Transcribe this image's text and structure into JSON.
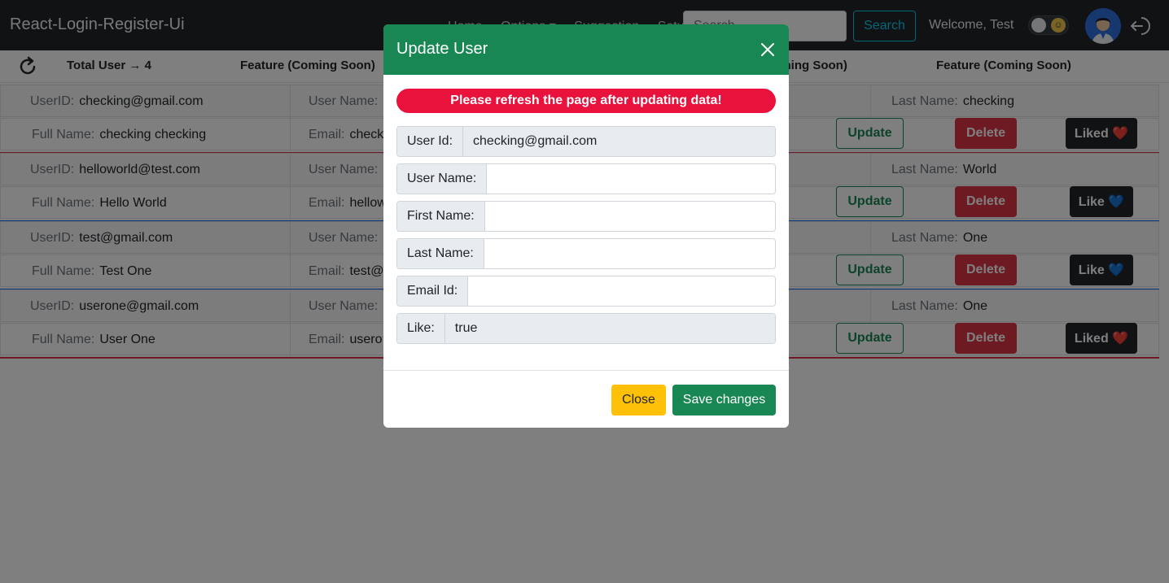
{
  "navbar": {
    "brand": "React-Login-Register-Ui",
    "links": [
      "Home",
      "Options ▾",
      "Suggestion",
      "Setup"
    ],
    "search_placeholder": "Search",
    "search_button": "Search",
    "welcome": "Welcome, Test"
  },
  "toolbar": {
    "total_users": "Total User → 4",
    "feature_1": "Feature (Coming Soon)",
    "feature_2": "Feature (Coming Soon)",
    "feature_3": "Feature (Coming Soon)"
  },
  "labels": {
    "user_id": "UserID:",
    "user_name": "User Name:",
    "last_name": "Last Name:",
    "full_name": "Full Name:",
    "email": "Email:",
    "update": "Update",
    "delete": "Delete"
  },
  "users": [
    {
      "user_id": "checking@gmail.com",
      "email": "check",
      "last_name": "checking",
      "full_name": "checking checking",
      "like_label": "Liked ❤️",
      "accent": "#dc3545"
    },
    {
      "user_id": "helloworld@test.com",
      "email": "hellow",
      "last_name": "World",
      "full_name": "Hello World",
      "like_label": "Like 💙",
      "accent": "#0d6efd"
    },
    {
      "user_id": "test@gmail.com",
      "email": "test@",
      "last_name": "One",
      "full_name": "Test One",
      "like_label": "Like 💙",
      "accent": "#0d6efd"
    },
    {
      "user_id": "userone@gmail.com",
      "email": "usero",
      "last_name": "One",
      "full_name": "User One",
      "like_label": "Liked ❤️",
      "accent": "#dc3545"
    }
  ],
  "modal": {
    "title": "Update User",
    "alert": "Please refresh the page after updating data!",
    "fields": {
      "user_id_label": "User Id:",
      "user_id_value": "checking@gmail.com",
      "user_name_label": "User Name:",
      "user_name_value": "",
      "first_name_label": "First Name:",
      "first_name_value": "",
      "last_name_label": "Last Name:",
      "last_name_value": "",
      "email_label": "Email Id:",
      "email_value": "",
      "like_label": "Like:",
      "like_value": "true"
    },
    "close_button": "Close",
    "save_button": "Save changes"
  },
  "colors": {
    "navbar_bg": "#212529",
    "modal_header": "#198754",
    "alert": "#e8123c",
    "close_button": "#ffc107",
    "save_button": "#198754",
    "delete_button": "#dc3545",
    "update_outline": "#198754",
    "search_outline": "#0dcaf0"
  },
  "icons": [
    "refresh-icon",
    "close-icon",
    "logout-icon",
    "avatar-icon",
    "sun-icon"
  ]
}
